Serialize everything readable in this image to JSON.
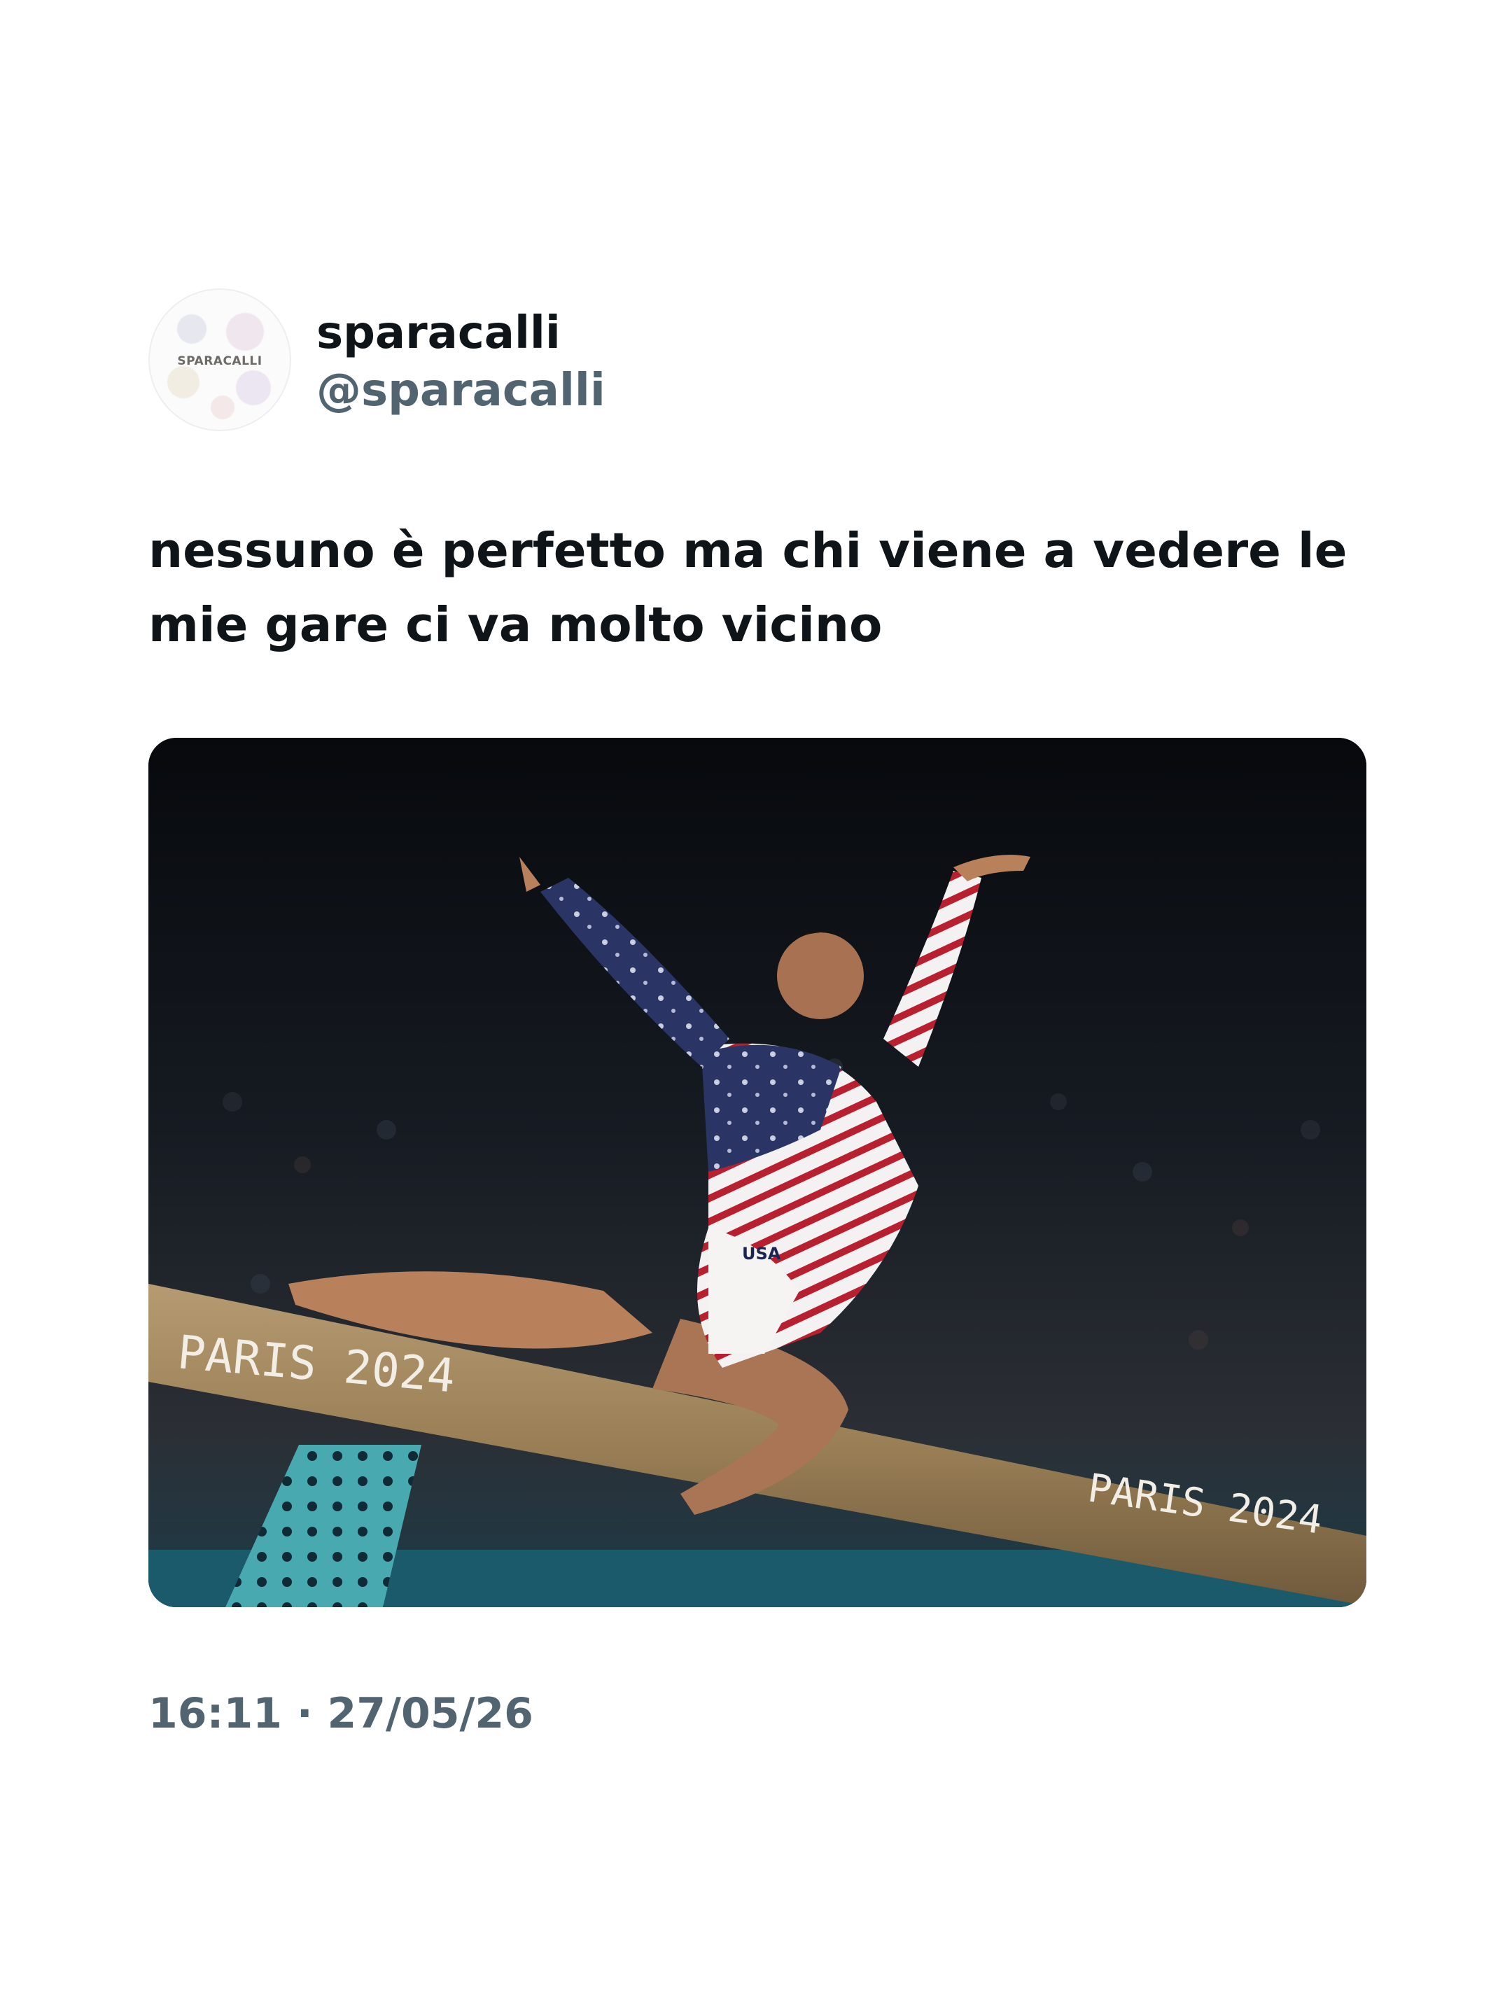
{
  "tweet": {
    "avatar_text": "SPARACALLI",
    "display_name": "sparacalli",
    "handle": "@sparacalli",
    "text": "nessuno è perfetto ma chi viene a vedere le mie gare ci va molto vicino",
    "timestamp": "16:11 · 27/05/26"
  },
  "media": {
    "image_label": "PARIS 2024 balance beam gymnast photo",
    "beam_text": "PARIS 2024",
    "suit_text": "USA"
  },
  "colors": {
    "text_primary": "#0f1419",
    "text_secondary": "#536471",
    "background": "#ffffff"
  }
}
